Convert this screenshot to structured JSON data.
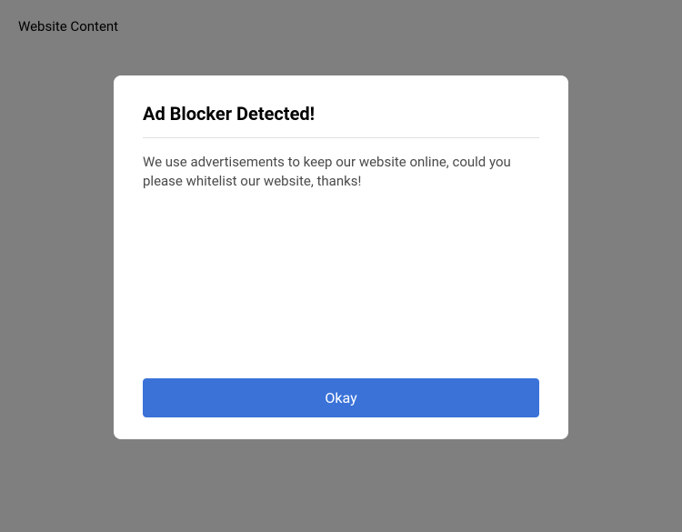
{
  "page": {
    "background_text": "Website Content"
  },
  "modal": {
    "title": "Ad Blocker Detected!",
    "message": "We use advertisements to keep our website online, could you please whitelist our website, thanks!",
    "okay_label": "Okay"
  },
  "colors": {
    "overlay": "rgba(0,0,0,0.5)",
    "primary_button": "#3a72d8"
  }
}
